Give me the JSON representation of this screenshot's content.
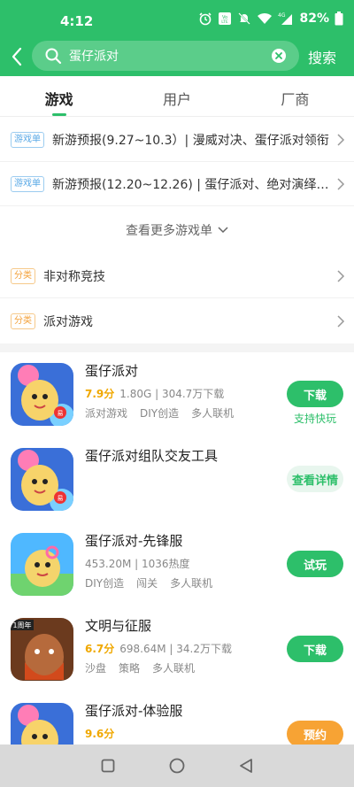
{
  "status_bar": {
    "time": "4:12",
    "battery": "82%",
    "network": "4G",
    "volte": "VoLTE"
  },
  "search": {
    "value": "蛋仔派对",
    "submit_label": "搜索"
  },
  "tabs": [
    {
      "label": "游戏",
      "active": true
    },
    {
      "label": "用户",
      "active": false
    },
    {
      "label": "厂商",
      "active": false
    }
  ],
  "game_lists": [
    {
      "tag": "游戏单",
      "title": "新游预报(9.27~10.3）| 漫威对决、蛋仔派对领衔"
    },
    {
      "tag": "游戏单",
      "title": "新游预报(12.20~12.26) | 蛋仔派对、绝对演绎领..."
    }
  ],
  "more_lists_label": "查看更多游戏单",
  "categories": [
    {
      "tag": "分类",
      "title": "非对称竞技"
    },
    {
      "tag": "分类",
      "title": "派对游戏"
    }
  ],
  "apps": [
    {
      "name": "蛋仔派对",
      "score": "7.9分",
      "info": "1.80G | 304.7万下载",
      "tags": [
        "派对游戏",
        "DIY创造",
        "多人联机"
      ],
      "button": "下载",
      "extra": "支持快玩"
    },
    {
      "name": "蛋仔派对组队交友工具",
      "score": "",
      "info": "",
      "tags": [],
      "button": "查看详情",
      "extra": ""
    },
    {
      "name": "蛋仔派对-先锋服",
      "score": "",
      "info": "453.20M | 1036热度",
      "tags": [
        "DIY创造",
        "闯关",
        "多人联机"
      ],
      "button": "试玩",
      "extra": ""
    },
    {
      "name": "文明与征服",
      "score": "6.7分",
      "info": "698.64M | 34.2万下载",
      "tags": [
        "沙盘",
        "策略",
        "多人联机"
      ],
      "button": "下载",
      "extra": "",
      "badge": "1周年"
    },
    {
      "name": "蛋仔派对-体验服",
      "score": "9.6分",
      "info": "",
      "tags": [],
      "button": "预约",
      "extra": ""
    }
  ],
  "colors": {
    "brand": "#2dbf6a",
    "score": "#f0a800",
    "reserve": "#f7a334"
  }
}
